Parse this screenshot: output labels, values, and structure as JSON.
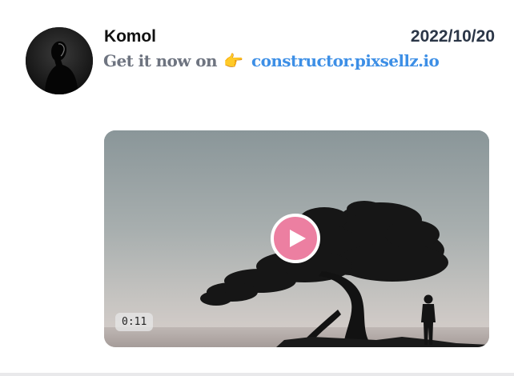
{
  "post": {
    "author": "Komol",
    "date": "2022/10/20",
    "message": {
      "text": "Get it now on",
      "emoji": "👉",
      "link": "constructor.pixsellz.io"
    },
    "video": {
      "duration": "0:11",
      "play_icon": "play-icon"
    }
  },
  "colors": {
    "link": "#3d8fe6",
    "message": "#6e7480",
    "play_button": "#ec7fa1",
    "date": "#2b3647"
  }
}
